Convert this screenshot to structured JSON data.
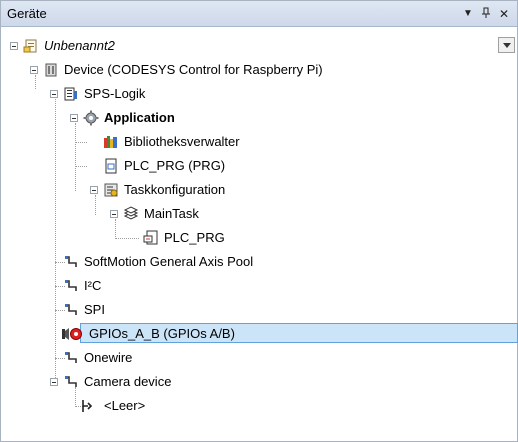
{
  "panel": {
    "title": "Geräte"
  },
  "tree": {
    "project": "Unbenannt2",
    "device": "Device (CODESYS Control for Raspberry Pi)",
    "plc_logic": "SPS-Logik",
    "application": "Application",
    "library_manager": "Bibliotheksverwalter",
    "plc_prg_pou": "PLC_PRG (PRG)",
    "task_config": "Taskkonfiguration",
    "main_task": "MainTask",
    "main_task_call": "PLC_PRG",
    "softmotion": "SoftMotion General Axis Pool",
    "i2c": "I²C",
    "spi": "SPI",
    "gpios": "GPIOs_A_B (GPIOs A/B)",
    "onewire": "Onewire",
    "camera": "Camera device",
    "empty_slot": "<Leer>"
  }
}
